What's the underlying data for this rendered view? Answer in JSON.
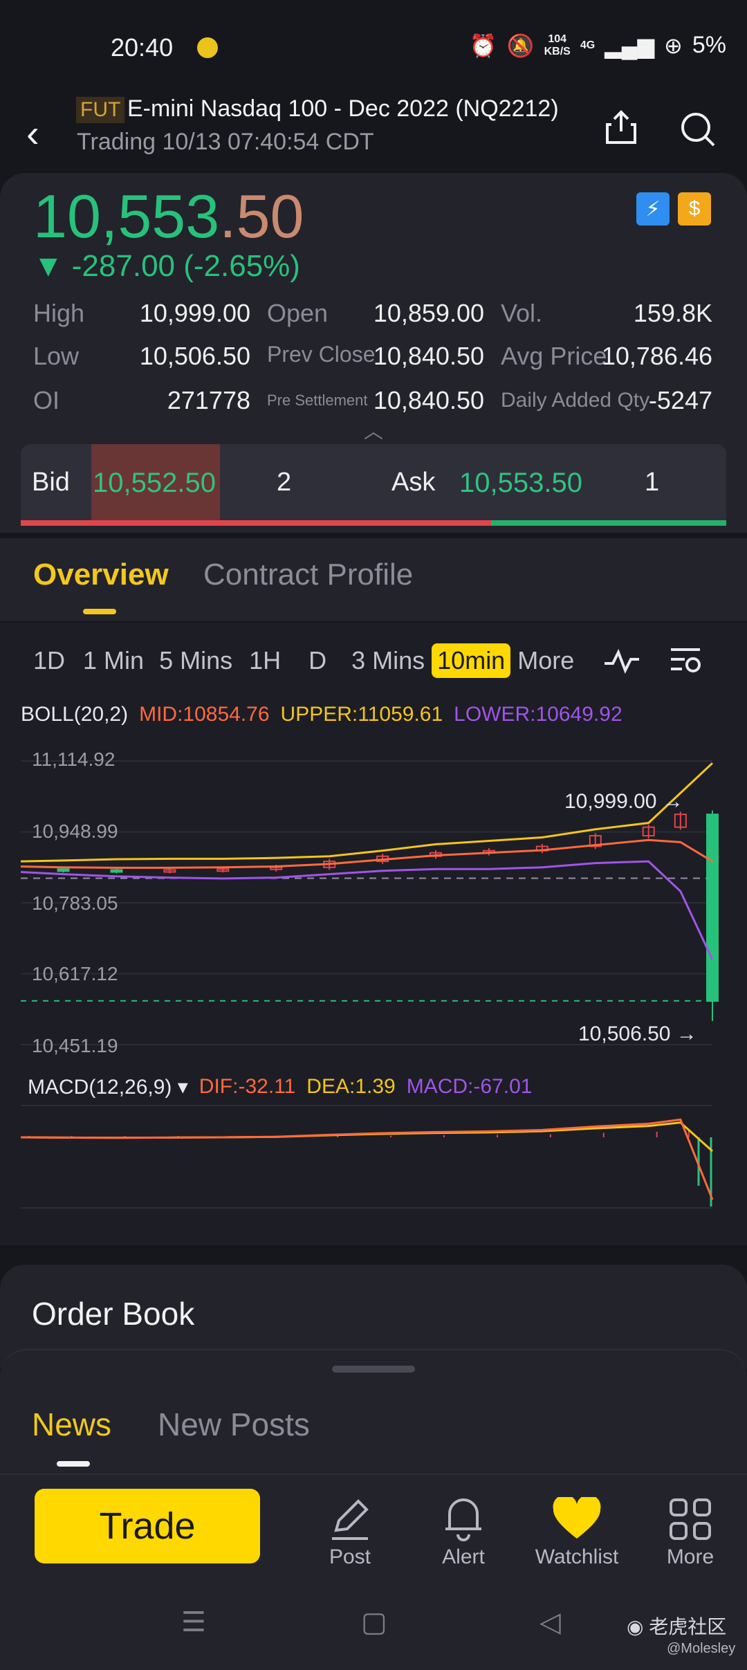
{
  "status_bar": {
    "time": "20:40",
    "speed_value": "104",
    "speed_unit": "KB/S",
    "network": "4G",
    "battery": "5%"
  },
  "header": {
    "badge": "FUT",
    "title": "E-mini Nasdaq 100 - Dec 2022 (NQ2212)",
    "subtitle": "Trading 10/13 07:40:54 CDT"
  },
  "quote": {
    "price_main": "10,553",
    "price_decimal": ".50",
    "change": "▼ -287.00 (-2.65%)",
    "badge_flash": "⚡",
    "badge_dollar": "$",
    "stats": [
      {
        "label": "High",
        "value": "10,999.00"
      },
      {
        "label": "Open",
        "value": "10,859.00"
      },
      {
        "label": "Vol.",
        "value": "159.8K"
      },
      {
        "label": "Low",
        "value": "10,506.50"
      },
      {
        "label": "Prev Close",
        "value": "10,840.50"
      },
      {
        "label": "Avg Price",
        "value": "10,786.46"
      },
      {
        "label": "OI",
        "value": "271778"
      },
      {
        "label": "Pre Settlement",
        "value": "10,840.50"
      },
      {
        "label": "Daily Added Qty",
        "value": "-5247"
      }
    ]
  },
  "bid_ask": {
    "bid_label": "Bid",
    "bid_price": "10,552.50",
    "bid_qty": "2",
    "ask_label": "Ask",
    "ask_price": "10,553.50",
    "ask_qty": "1",
    "bid_share": 0.667
  },
  "tabs": {
    "overview": "Overview",
    "contract": "Contract Profile"
  },
  "chart": {
    "intervals": [
      "1D",
      "1 Min",
      "5 Mins",
      "1H",
      "D",
      "3 Mins",
      "10min",
      "More"
    ],
    "selected_interval": "10min",
    "boll": {
      "name": "BOLL(20,2)",
      "mid": "MID:10854.76",
      "upper": "UPPER:11059.61",
      "lower": "LOWER:10649.92"
    },
    "y_labels": [
      "11,114.92",
      "10,948.99",
      "10,783.05",
      "10,617.12",
      "10,451.19"
    ],
    "high_marker": "10,999.00 →",
    "low_marker": "10,506.50 →",
    "macd": {
      "name": "MACD(12,26,9) ▾",
      "dif": "DIF:-32.11",
      "dea": "DEA:1.39",
      "macd": "MACD:-67.01"
    },
    "colors": {
      "up": "#27c27a",
      "down": "#e0454a",
      "mid": "#ff6a3d",
      "upper": "#f5c518",
      "lower": "#a055e8"
    }
  },
  "chart_data": {
    "type": "line",
    "title": "",
    "xlabel": "",
    "ylabel": "",
    "ylim": [
      10451.19,
      11114.92
    ],
    "y_ticks": [
      11114.92,
      10948.99,
      10783.05,
      10617.12,
      10451.19
    ],
    "x": [
      1,
      5,
      10,
      15,
      20,
      25,
      30,
      35,
      40,
      45,
      50,
      55,
      60,
      63,
      66
    ],
    "series": [
      {
        "name": "UPPER",
        "values": [
          10880,
          10882,
          10885,
          10886,
          10886,
          10888,
          10892,
          10905,
          10920,
          10928,
          10936,
          10955,
          10970,
          11040,
          11110
        ]
      },
      {
        "name": "MID",
        "values": [
          10868,
          10866,
          10865,
          10865,
          10866,
          10868,
          10874,
          10884,
          10894,
          10900,
          10906,
          10918,
          10930,
          10925,
          10880
        ]
      },
      {
        "name": "LOWER",
        "values": [
          10855,
          10850,
          10845,
          10842,
          10840,
          10842,
          10850,
          10858,
          10862,
          10862,
          10866,
          10876,
          10880,
          10810,
          10650
        ]
      }
    ],
    "close_series": [
      10862,
      10860,
      10858,
      10860,
      10862,
      10866,
      10880,
      10892,
      10900,
      10905,
      10915,
      10940,
      10960,
      10990,
      10553
    ],
    "high": 10999.0,
    "low": 10506.5,
    "last_price": 10553.5,
    "prev_close": 10840.5,
    "legend": "top-left",
    "grid": true
  },
  "order_book": {
    "title": "Order Book"
  },
  "news": {
    "news": "News",
    "posts": "New Posts"
  },
  "bottom_nav": {
    "trade": "Trade",
    "post": "Post",
    "alert": "Alert",
    "watchlist": "Watchlist",
    "more": "More"
  },
  "watermark": {
    "brand": "老虎社区",
    "user": "@Molesley"
  }
}
